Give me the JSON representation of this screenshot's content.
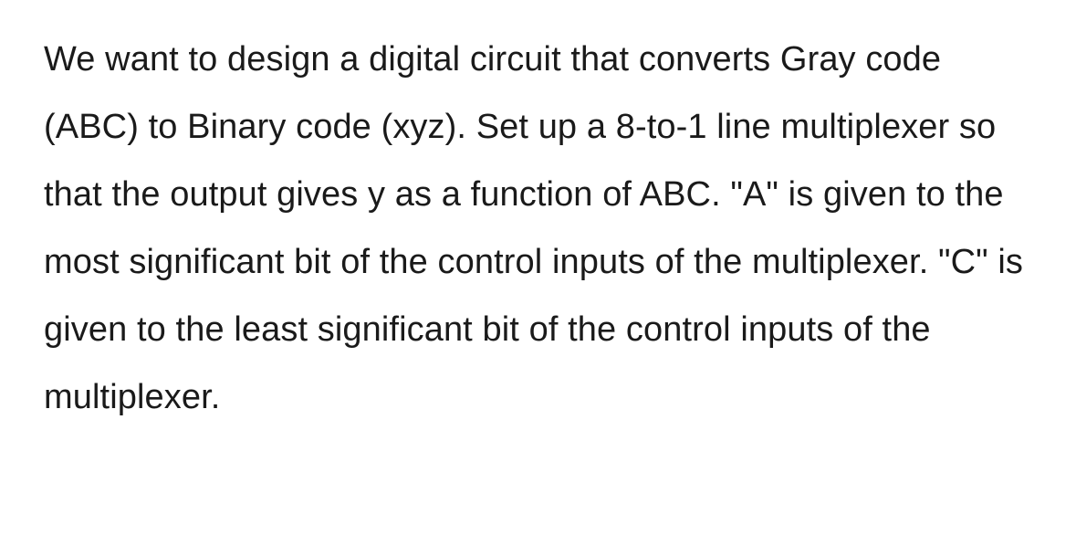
{
  "problem": {
    "text": "We want to design a digital circuit that converts Gray code (ABC) to Binary code (xyz). Set up a 8-to-1 line multiplexer so that the output gives y as a function of ABC. \"A\" is given to the most significant bit of the control inputs of the multiplexer. \"C\" is given to the least significant bit of the control inputs of the multiplexer."
  }
}
